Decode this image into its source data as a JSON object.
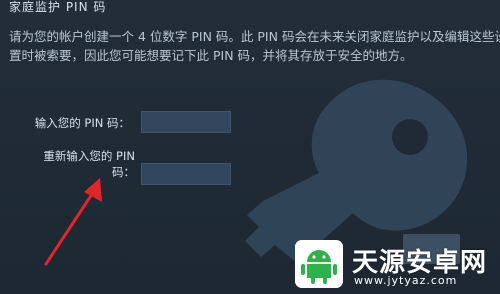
{
  "dialog": {
    "title": "家庭监护 PIN 码",
    "description": "请为您的帐户创建一个 4 位数字 PIN 码。此 PIN 码会在未来关闭家庭监护以及编辑这些设置时被索要，因此您可能想要记下此 PIN 码，并将其存放于安全的地方。"
  },
  "form": {
    "pin_label": "输入您的 PIN 码：",
    "pin_value": "",
    "confirm_label_line1": "重新输入您的 PIN",
    "confirm_label_line2": "码：",
    "confirm_value": ""
  },
  "watermark": {
    "title": "天源安卓网",
    "url": "www.jytyaz.com"
  },
  "colors": {
    "background": "#1f2a36",
    "input_bg": "#32475d",
    "arrow": "#e0262b",
    "watermark_green": "#2fb24c"
  },
  "icons": [
    "key-icon",
    "arrow-pointer",
    "android-logo"
  ]
}
